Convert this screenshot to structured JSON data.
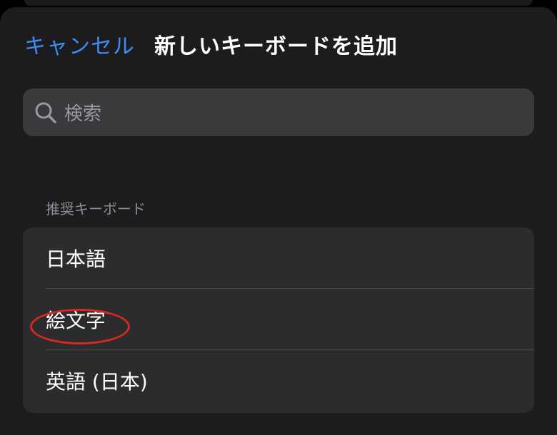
{
  "nav": {
    "cancel_label": "キャンセル",
    "title": "新しいキーボードを追加"
  },
  "search": {
    "placeholder": "検索"
  },
  "section": {
    "header": "推奨キーボード",
    "items": [
      {
        "label": "日本語"
      },
      {
        "label": "絵文字"
      },
      {
        "label": "英語 (日本)"
      }
    ]
  },
  "colors": {
    "accent": "#3b8ef0",
    "sheet_background": "#1c1c1e",
    "group_background": "#2c2c2e",
    "annotation": "#d6291f"
  },
  "icons": {
    "search": "search-icon"
  }
}
